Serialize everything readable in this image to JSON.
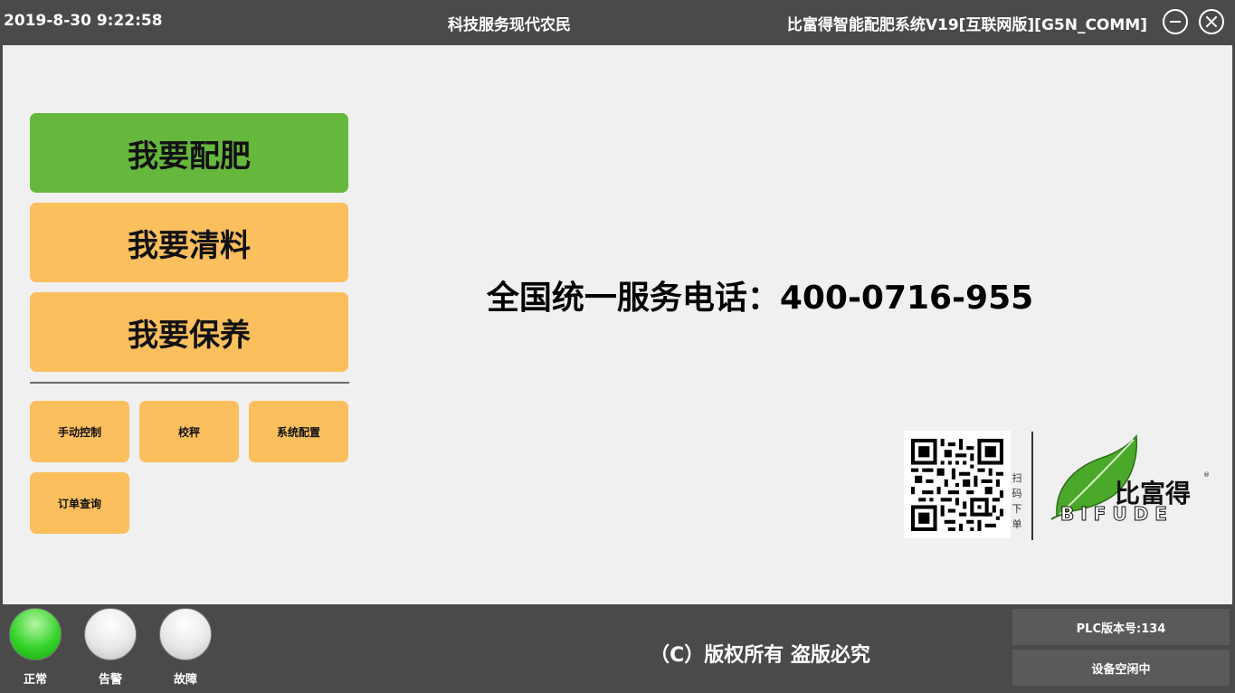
{
  "titlebar": {
    "datetime": "2019-8-30 9:22:58",
    "slogan": "科技服务现代农民",
    "app_title": "比富得智能配肥系统V19[互联网版][G5N_COMM]"
  },
  "main_buttons": {
    "fertilize": "我要配肥",
    "clean": "我要清料",
    "maintain": "我要保养"
  },
  "small_buttons": {
    "manual_control": "手动控制",
    "calibrate": "校秤",
    "system_config": "系统配置",
    "order_query": "订单查询"
  },
  "hotline": "全国统一服务电话：400-0716-955",
  "qr": {
    "caption": "扫码下单"
  },
  "logo": {
    "name_cn": "比富得",
    "name_en": "BIFUDE",
    "reg_mark": "®"
  },
  "status_lamps": [
    {
      "label": "正常",
      "state": "on"
    },
    {
      "label": "告警",
      "state": "off"
    },
    {
      "label": "故障",
      "state": "off"
    }
  ],
  "copyright": "（C）版权所有 盗版必究",
  "plc_version": "PLC版本号:134",
  "device_status": "设备空闲中",
  "colors": {
    "titlebar": "#4a4a4a",
    "active_button": "#65b83c",
    "button": "#fbbf5e",
    "background": "#f0f0f0",
    "leaf_green": "#4aa82a"
  }
}
